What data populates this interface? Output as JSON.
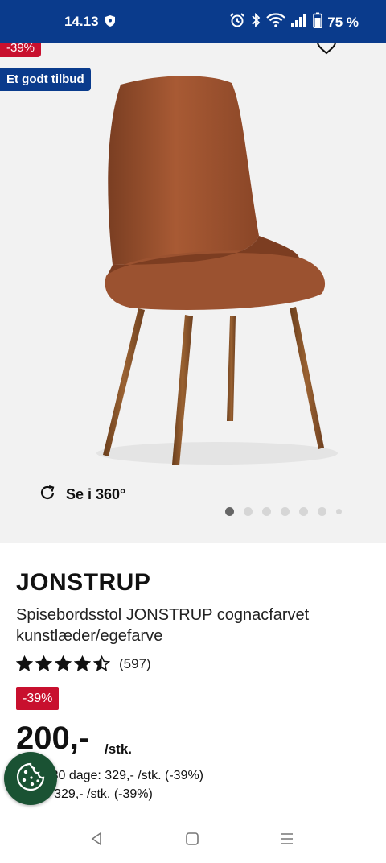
{
  "status_bar": {
    "time": "14.13",
    "battery": "75 %"
  },
  "product_image": {
    "discount_badge": "-39%",
    "deal_badge": "Et godt tilbud",
    "view_360_label": "Se i 360°",
    "carousel_dot_count": 7,
    "carousel_active_index": 0
  },
  "product": {
    "brand": "JONSTRUP",
    "description": "Spisebordsstol JONSTRUP cognacfarvet kunstlæder/egefarve",
    "rating": 4.5,
    "rating_count": "(597)",
    "discount_badge": "-39%",
    "price": "200,-",
    "unit": "/stk.",
    "lowest_price_line": "e pris 30 dage: 329,- /stk. (-39%)",
    "normal_price_line": "alpris: 329,- /stk. (-39%)"
  },
  "colors": {
    "brand_blue": "#0a3b8c",
    "discount_red": "#c8102e",
    "cookie_green": "#1a5233"
  }
}
